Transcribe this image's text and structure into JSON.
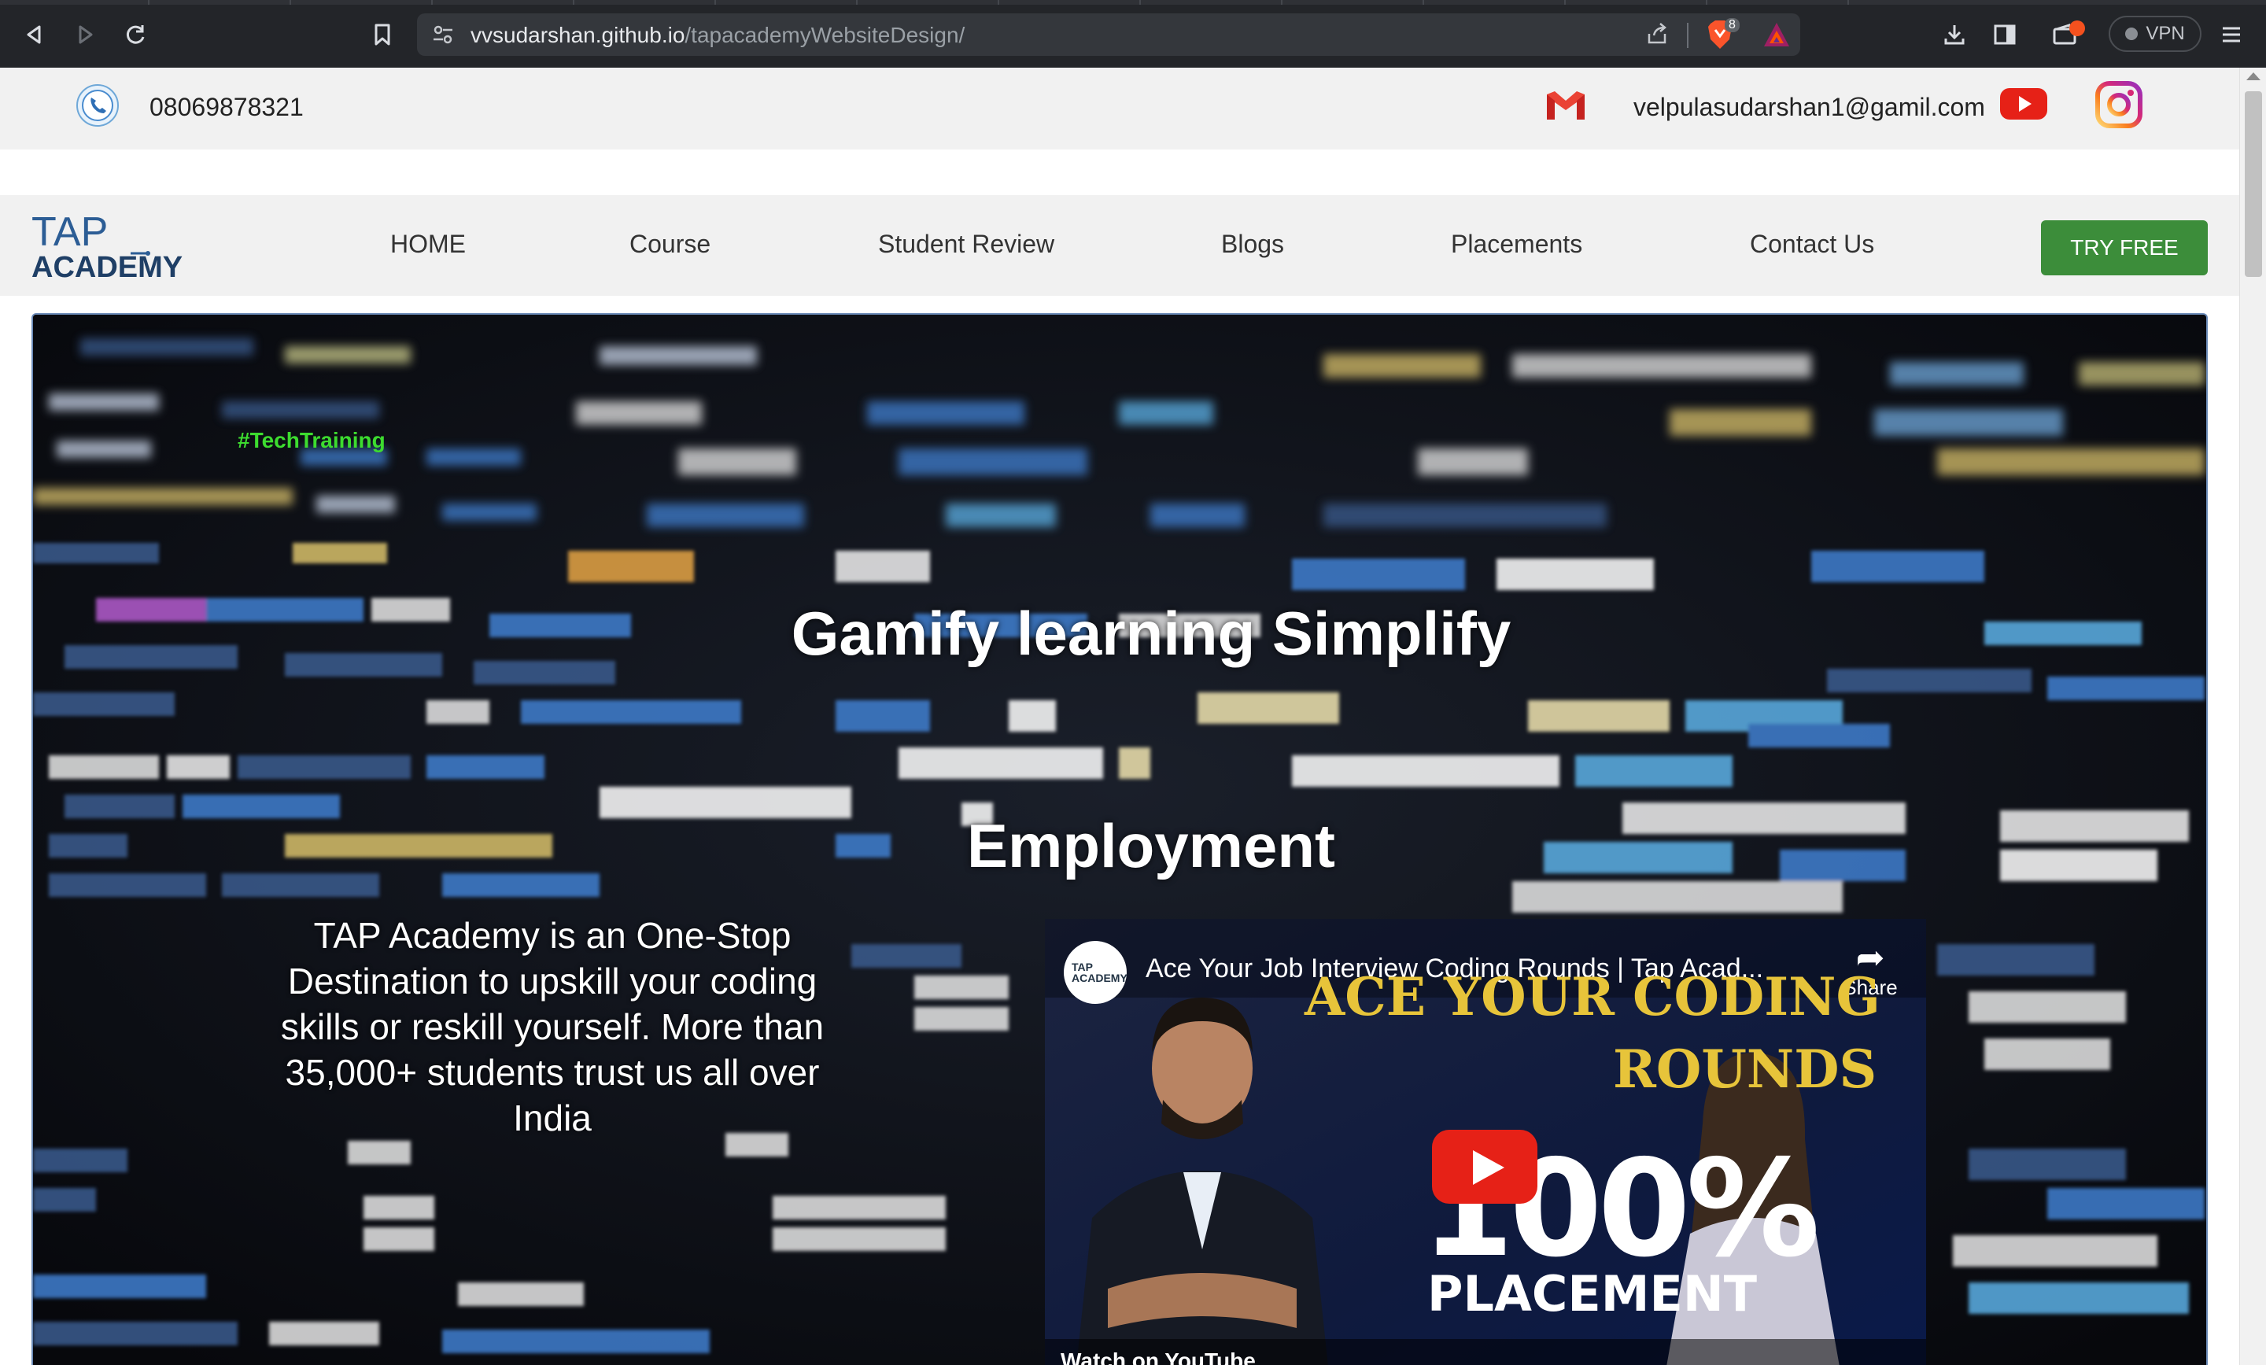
{
  "browser": {
    "url_host": "vvsudarshan.github.io",
    "url_path": "/tapacademyWebsiteDesign/",
    "shields_count": "8",
    "vpn_label": "VPN",
    "icons": [
      "back-icon",
      "forward-icon",
      "reload-icon",
      "bookmark-icon",
      "site-settings-icon",
      "share-icon",
      "brave-shields-icon",
      "brave-rewards-icon",
      "download-icon",
      "sidebar-icon",
      "wallet-icon",
      "menu-icon"
    ]
  },
  "contact_bar": {
    "phone": "08069878321",
    "email": "velpulasudarshan1@gamil.com",
    "icons": [
      "phone-icon",
      "gmail-icon",
      "youtube-icon",
      "instagram-icon"
    ]
  },
  "nav": {
    "logo_line1": "TAP",
    "logo_line2": "ACADEMY",
    "items": [
      "HOME",
      "Course",
      "Student Review",
      "Blogs",
      "Placements",
      "Contact Us"
    ],
    "cta": "TRY FREE"
  },
  "hero": {
    "tag": "#TechTraining",
    "title_line1": "Gamify learning Simplify",
    "title_line2": "Employment",
    "description": "TAP Academy is an One-Stop Destination to upskill your coding skills or reskill yourself. More than 35,000+ students trust us all over India"
  },
  "video": {
    "title": "Ace Your Job Interview Coding Rounds | Tap Acad...",
    "channel_logo": "TAP ACADEMY",
    "share_label": "Share",
    "thumb_line1": "ACE YOUR CODING",
    "thumb_line2": "ROUNDS",
    "thumb_pct": "100%",
    "thumb_line3": "PLACEMENT",
    "watch_on": "Watch on YouTube"
  },
  "colors": {
    "accent_green": "#3c8d3a",
    "tag_green": "#3ddc2f",
    "youtube_red": "#e62117",
    "thumb_yellow": "#e7c43a"
  }
}
